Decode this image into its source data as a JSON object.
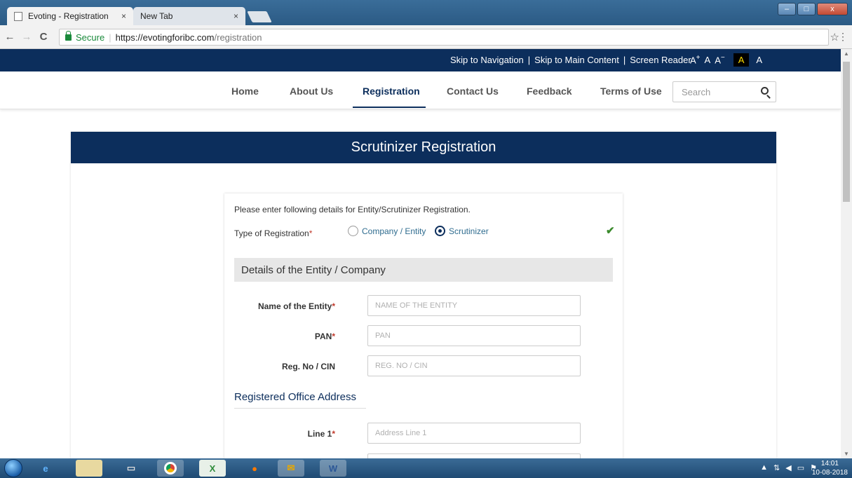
{
  "browser": {
    "tabs": [
      {
        "title": "Evoting - Registration",
        "close": "×"
      },
      {
        "title": "New Tab",
        "close": "×"
      }
    ],
    "nav": {
      "back": "←",
      "forward": "→",
      "reload": "C"
    },
    "address": {
      "secure_label": "Secure",
      "separator": "|",
      "url_host": "https://evotingforibc.com",
      "url_path": "/registration"
    },
    "star": "☆",
    "menu": "⋮",
    "window_controls": {
      "minimize": "–",
      "maximize": "□",
      "close": "x"
    }
  },
  "accessibility_bar": {
    "skip_navigation": "Skip to Navigation",
    "skip_main": "Skip to Main Content",
    "screen_reader": "Screen Reader",
    "separator": "|",
    "font_increase": "A",
    "font_increase_sup": "+",
    "font_normal": "A",
    "font_decrease": "A",
    "font_decrease_sup": "−",
    "contrast_dark": "A",
    "contrast_default": "A"
  },
  "main_nav": {
    "items": [
      {
        "label": "Home"
      },
      {
        "label": "About Us"
      },
      {
        "label": "Registration"
      },
      {
        "label": "Contact Us"
      },
      {
        "label": "Feedback"
      },
      {
        "label": "Terms of Use"
      }
    ],
    "search_placeholder": "Search"
  },
  "card": {
    "title": "Scrutinizer Registration"
  },
  "form": {
    "intro": "Please enter following details for Entity/Scrutinizer Registration.",
    "type_label": "Type of Registration",
    "required_mark": "*",
    "radio_options": [
      {
        "label": "Company / Entity",
        "checked": false
      },
      {
        "label": "Scrutinizer",
        "checked": true
      }
    ],
    "valid_check": "✔",
    "section_title": "Details of the Entity / Company",
    "fields": [
      {
        "label": "Name of the Entity",
        "required": "*",
        "placeholder": "NAME OF THE ENTITY"
      },
      {
        "label": "PAN",
        "required": "*",
        "placeholder": "PAN"
      },
      {
        "label": "Reg. No / CIN",
        "required": "",
        "placeholder": "REG. NO / CIN"
      }
    ],
    "address_heading": "Registered Office Address",
    "address_fields": [
      {
        "label": "Line 1",
        "required": "*",
        "placeholder": "Address Line 1"
      }
    ]
  },
  "taskbar": {
    "time": "14:01",
    "date": "10-08-2018",
    "tray_icons": [
      "arrow-up-icon",
      "network-icon",
      "volume-icon",
      "monitor-icon",
      "flag-icon"
    ]
  }
}
